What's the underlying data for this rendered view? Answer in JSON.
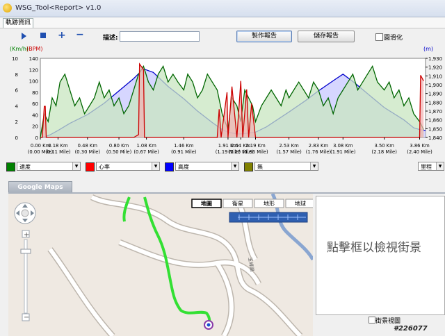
{
  "window": {
    "title": "WSG_Tool<Report> v1.0"
  },
  "tabs": [
    {
      "label": "軌跡資訊"
    }
  ],
  "toolbar": {
    "play": "play-icon",
    "stop": "stop-icon",
    "add": "+",
    "remove": "−",
    "description_label": "描述:",
    "description_value": "",
    "make_report": "製作報告",
    "save_report": "儲存報告",
    "smooth_label": "圓滑化",
    "smooth_checked": false
  },
  "chart_data": {
    "type": "line",
    "left_axis_speed": {
      "label": "(Km/h)",
      "ticks": [
        "10",
        "8",
        "6",
        "4",
        "2",
        "0"
      ],
      "ylim": [
        0,
        10
      ]
    },
    "left_axis_hr": {
      "label": "(BPM)",
      "ticks": [
        "140",
        "120",
        "100",
        "80",
        "60",
        "40",
        "20",
        "0"
      ],
      "ylim": [
        0,
        140
      ]
    },
    "right_axis": {
      "label": "(m)",
      "ticks": [
        "1,930",
        "1,920",
        "1,910",
        "1,900",
        "1,890",
        "1,880",
        "1,870",
        "1,860",
        "1,850",
        "1,840"
      ],
      "ylim": [
        1840,
        1930
      ]
    },
    "x_ticks": [
      {
        "km": "0.00 Km",
        "mile": "(0.00 Mile)"
      },
      {
        "km": "0.18 Km",
        "mile": "(0.11 Mile)"
      },
      {
        "km": "0.48 Km",
        "mile": "(0.30 Mile)"
      },
      {
        "km": "0.80 Km",
        "mile": "(0.50 Mile)"
      },
      {
        "km": "1.08 Km",
        "mile": "(0.67 Mile)"
      },
      {
        "km": "1.46 Km",
        "mile": "(0.91 Mile)"
      },
      {
        "km": "1.91 Km",
        "mile": "(1.19 Mile)"
      },
      {
        "km": "2.04 Km",
        "mile": "(1.27 Mile)"
      },
      {
        "km": "2.19 Km",
        "mile": "(1.36 Mile)"
      },
      {
        "km": "2.53 Km",
        "mile": "(1.57 Mile)"
      },
      {
        "km": "2.83 Km",
        "mile": "(1.76 Mile)"
      },
      {
        "km": "3.08 Km",
        "mile": "(1.91 Mile)"
      },
      {
        "km": "3.50 Km",
        "mile": "(2.18 Mile)"
      },
      {
        "km": "3.86 Km",
        "mile": "(2.40 Mile)"
      }
    ],
    "series": [
      {
        "name": "高度",
        "color": "#0000cc",
        "fill": "#c8c8ff",
        "axis": "m",
        "x": [
          0,
          0.05,
          0.1,
          0.18,
          0.3,
          0.48,
          0.65,
          0.8,
          0.95,
          1.05,
          1.15,
          1.3,
          1.46,
          1.6,
          1.75,
          1.85,
          1.91,
          2.0,
          2.04,
          2.12,
          2.19,
          2.3,
          2.53,
          2.7,
          2.83,
          3.0,
          3.08,
          3.2,
          3.35,
          3.5,
          3.7,
          3.8,
          3.86,
          3.92
        ],
        "y": [
          1840,
          1841,
          1843,
          1848,
          1856,
          1866,
          1879,
          1893,
          1907,
          1918,
          1914,
          1898,
          1884,
          1870,
          1857,
          1849,
          1846,
          1844,
          1844,
          1845,
          1846,
          1852,
          1869,
          1882,
          1893,
          1906,
          1912,
          1902,
          1888,
          1874,
          1860,
          1851,
          1849,
          1848
        ]
      },
      {
        "name": "速度",
        "color": "#006600",
        "fill": "#c8e6c0",
        "axis": "kmh",
        "x": [
          0,
          0.04,
          0.08,
          0.12,
          0.16,
          0.2,
          0.25,
          0.3,
          0.35,
          0.4,
          0.45,
          0.5,
          0.55,
          0.6,
          0.65,
          0.7,
          0.75,
          0.8,
          0.85,
          0.9,
          0.95,
          1.0,
          1.05,
          1.1,
          1.15,
          1.2,
          1.25,
          1.3,
          1.35,
          1.4,
          1.46,
          1.5,
          1.55,
          1.6,
          1.65,
          1.7,
          1.75,
          1.8,
          1.85,
          1.91,
          1.95,
          2.0,
          2.04,
          2.08,
          2.12,
          2.16,
          2.19,
          2.25,
          2.3,
          2.35,
          2.4,
          2.45,
          2.5,
          2.53,
          2.58,
          2.63,
          2.68,
          2.73,
          2.78,
          2.83,
          2.88,
          2.93,
          2.98,
          3.03,
          3.08,
          3.13,
          3.18,
          3.23,
          3.28,
          3.33,
          3.38,
          3.43,
          3.5,
          3.55,
          3.6,
          3.65,
          3.7,
          3.75,
          3.8,
          3.86,
          3.9
        ],
        "y": [
          0,
          3,
          2,
          5,
          4,
          7,
          8,
          6,
          4,
          5,
          3,
          4,
          5,
          7,
          5,
          6,
          4,
          5,
          3,
          4,
          6,
          8,
          9,
          7,
          6,
          8,
          9,
          7,
          8,
          7,
          6,
          8,
          7,
          5,
          6,
          8,
          7,
          6,
          3,
          1,
          5,
          4,
          2,
          6,
          5,
          4,
          2,
          4,
          5,
          6,
          5,
          4,
          6,
          5,
          6,
          7,
          6,
          5,
          7,
          6,
          4,
          5,
          3,
          5,
          6,
          7,
          8,
          6,
          7,
          8,
          9,
          7,
          6,
          7,
          5,
          6,
          4,
          5,
          3,
          2,
          1
        ]
      },
      {
        "name": "心率",
        "color": "#cc0000",
        "fill": "#f0b4b4",
        "axis": "bpm",
        "x": [
          0,
          0.02,
          0.04,
          0.05,
          0.06,
          0.1,
          0.95,
          1.0,
          1.01,
          1.05,
          1.06,
          1.8,
          1.82,
          1.84,
          1.9,
          1.91,
          1.95,
          2.0,
          2.04,
          2.06,
          2.1,
          2.12,
          2.15,
          2.19,
          2.2,
          3.86,
          3.87,
          3.9
        ],
        "y": [
          0,
          0,
          55,
          55,
          0,
          0,
          0,
          5,
          130,
          120,
          0,
          0,
          50,
          0,
          80,
          0,
          90,
          0,
          100,
          0,
          85,
          0,
          60,
          0,
          0,
          0,
          110,
          100
        ]
      }
    ]
  },
  "legend_row": [
    {
      "color": "#008000",
      "value": "速度"
    },
    {
      "color": "#ff0000",
      "value": "心率"
    },
    {
      "color": "#0000ff",
      "value": "高度"
    },
    {
      "color": "#808000",
      "value": "無"
    }
  ],
  "distance_unit": "里程",
  "maps": {
    "header": "Google Maps",
    "map_types": [
      "地圖",
      "衛星",
      "地形",
      "地球"
    ],
    "active_map_type": "地圖",
    "road_label": "五峰路",
    "street_view_message": "點擊框以檢視街景",
    "street_view_checkbox": "街景視圖"
  },
  "watermark": "#226077"
}
